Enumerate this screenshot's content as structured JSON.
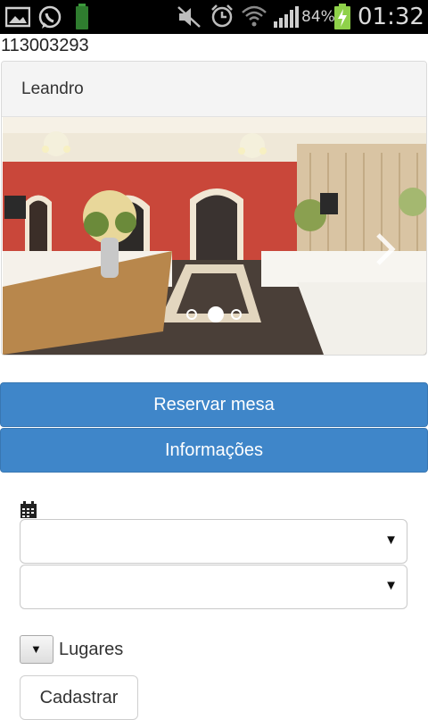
{
  "status_bar": {
    "battery_percent": "84%",
    "time": "01:32",
    "icons": [
      "gallery-icon",
      "whatsapp-icon",
      "battery-notification-icon",
      "mute-icon",
      "alarm-icon",
      "wifi-icon",
      "signal-icon",
      "battery-charging-icon"
    ]
  },
  "page": {
    "id_text": "113003293"
  },
  "panel": {
    "title": "Leandro",
    "carousel": {
      "slide_count": 3,
      "active_index": 1
    }
  },
  "buttons": {
    "reserve_label": "Reservar mesa",
    "info_label": "Informações",
    "submit_label": "Cadastrar"
  },
  "form": {
    "date_select_value": "",
    "time_select_value": "",
    "places_label": "Lugares"
  },
  "colors": {
    "primary": "#3f86c9",
    "status_bar": "#000000"
  }
}
